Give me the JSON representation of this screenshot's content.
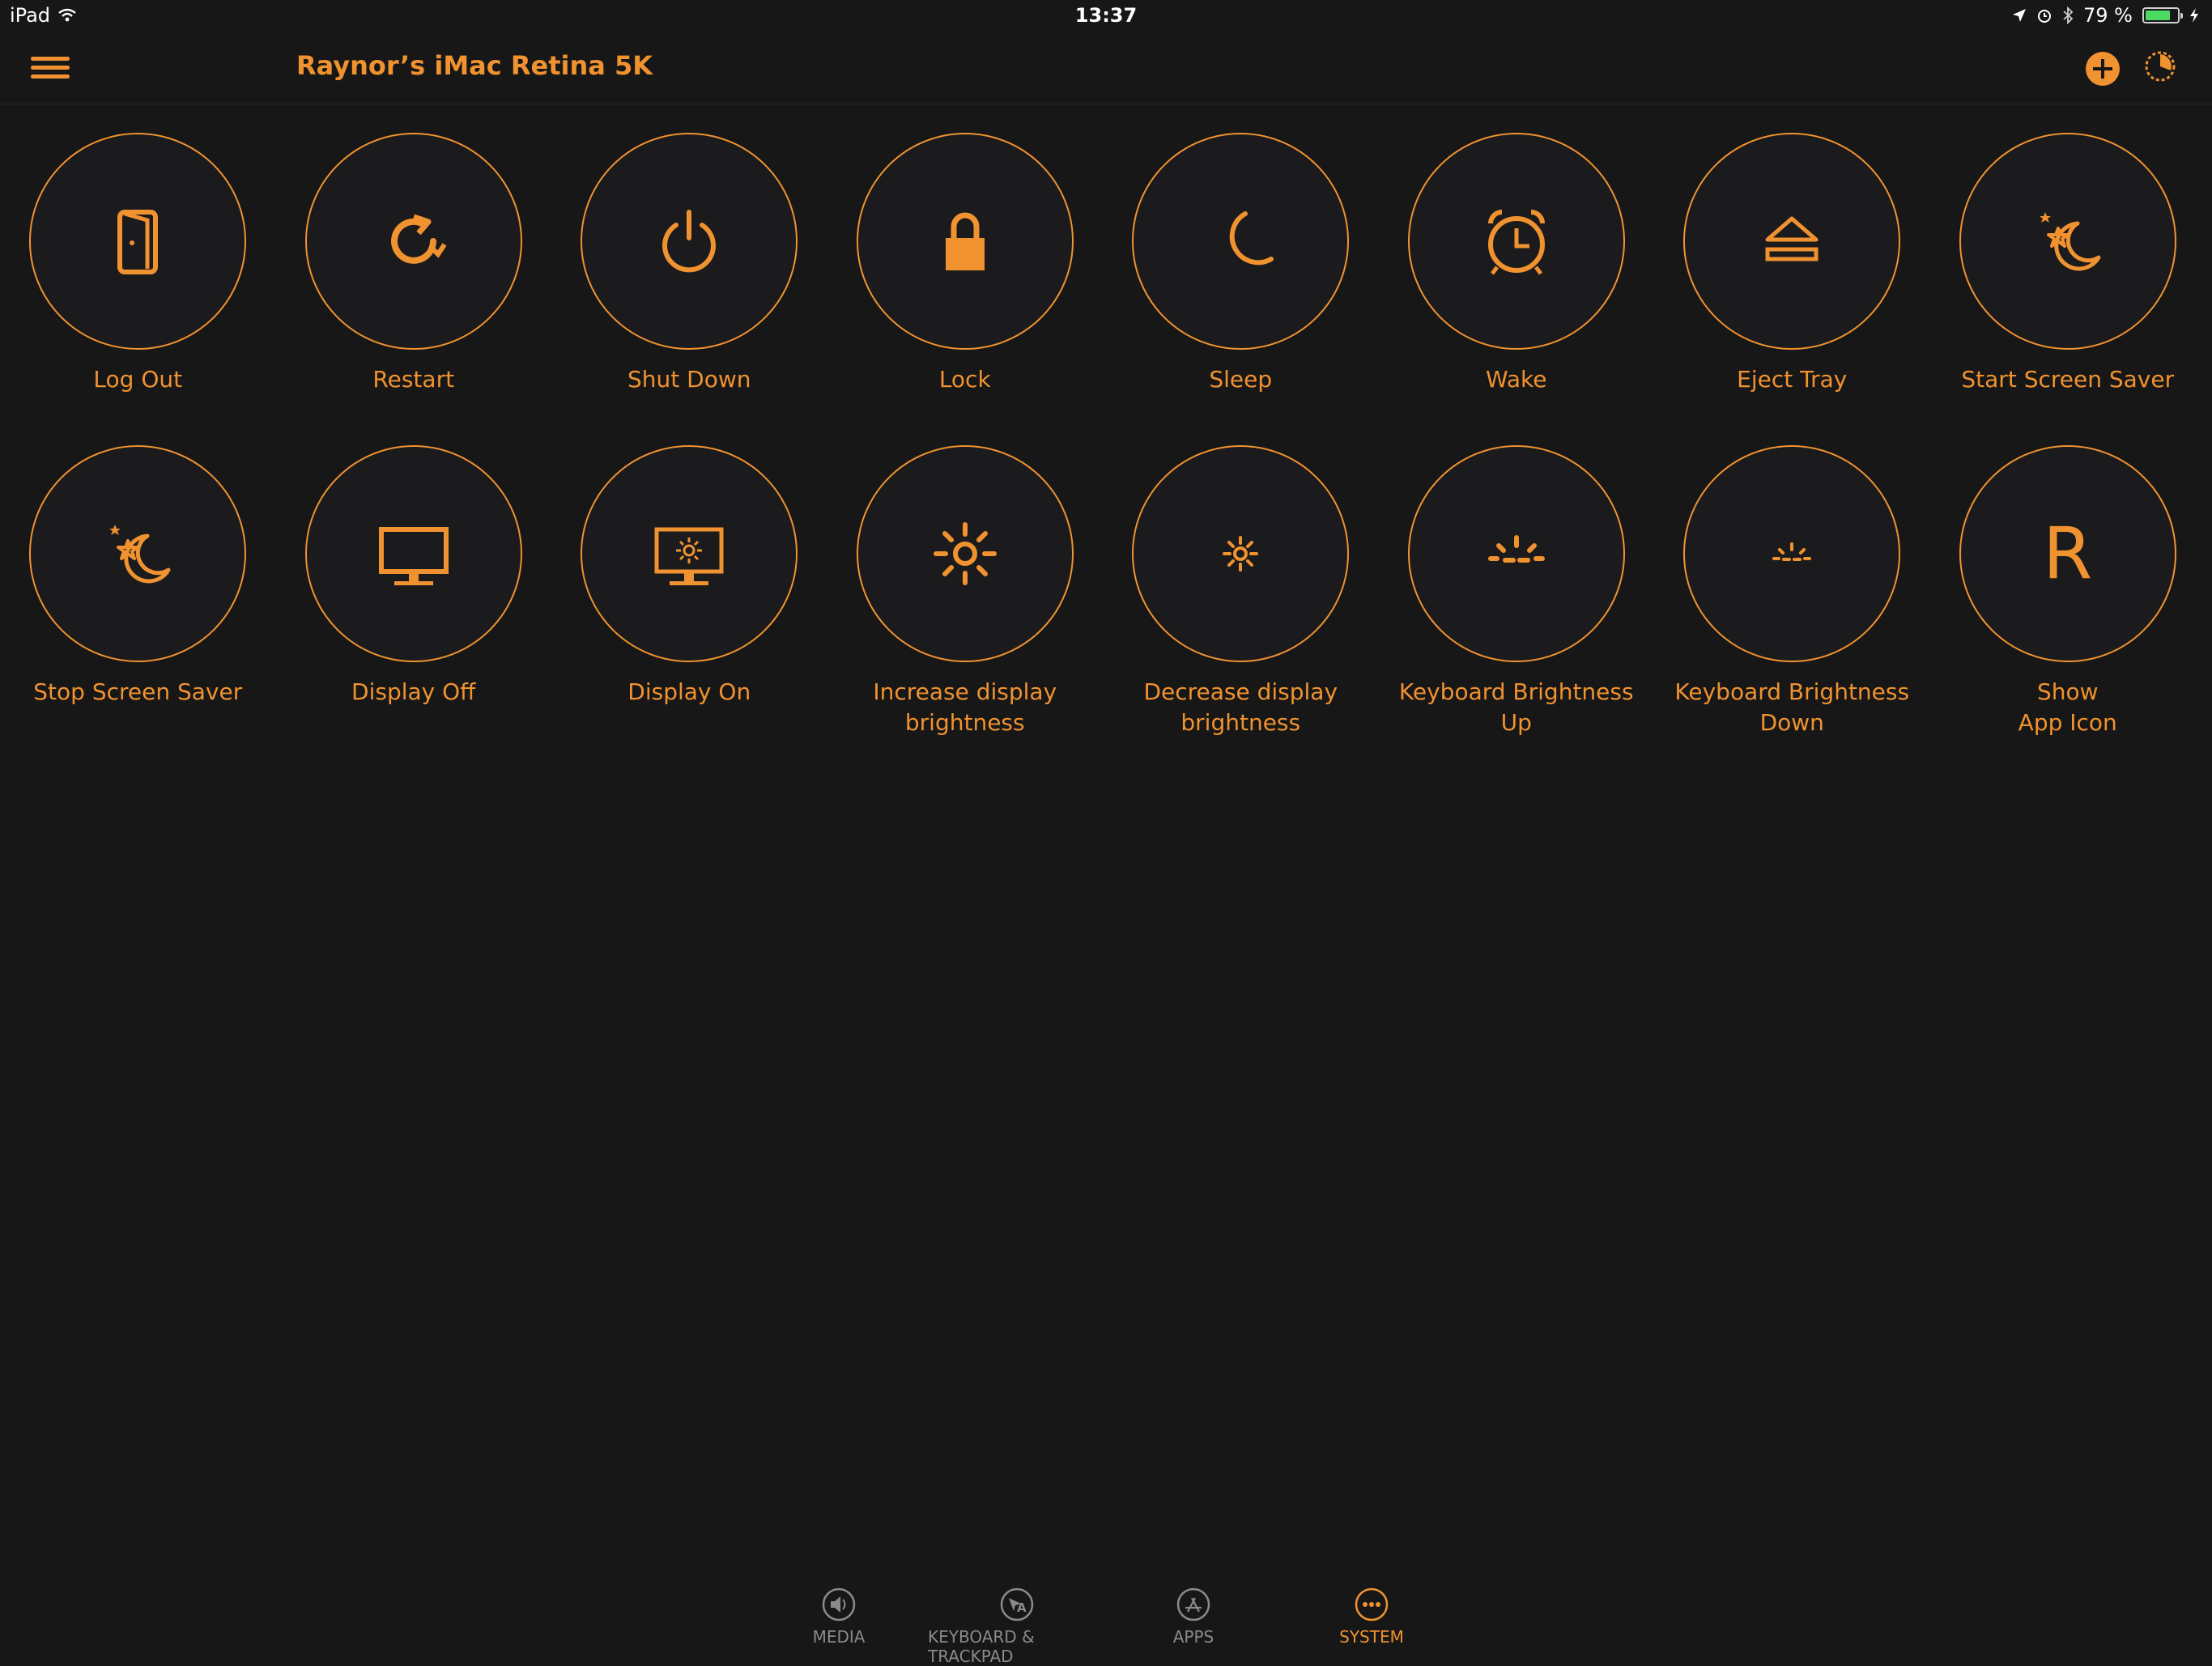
{
  "status_bar": {
    "device": "iPad",
    "time": "13:37",
    "battery_percent": "79 %",
    "battery_level": 0.79
  },
  "navbar": {
    "title": "Raynor’s iMac Retina 5K"
  },
  "actions": [
    {
      "label": "Log Out",
      "icon": "door-icon"
    },
    {
      "label": "Restart",
      "icon": "restart-icon"
    },
    {
      "label": "Shut Down",
      "icon": "power-icon"
    },
    {
      "label": "Lock",
      "icon": "lock-icon"
    },
    {
      "label": "Sleep",
      "icon": "moon-icon"
    },
    {
      "label": "Wake",
      "icon": "alarm-clock-icon"
    },
    {
      "label": "Eject Tray",
      "icon": "eject-icon"
    },
    {
      "label": "Start Screen Saver",
      "icon": "moon-stars-icon"
    },
    {
      "label": "Stop Screen Saver",
      "icon": "moon-stars-icon"
    },
    {
      "label": "Display Off",
      "icon": "monitor-icon"
    },
    {
      "label": "Display On",
      "icon": "monitor-sun-icon"
    },
    {
      "label": "Increase display\nbrightness",
      "icon": "sun-large-icon"
    },
    {
      "label": "Decrease display\nbrightness",
      "icon": "sun-small-icon"
    },
    {
      "label": "Keyboard Brightness\nUp",
      "icon": "keyboard-brightness-up-icon"
    },
    {
      "label": "Keyboard Brightness\nDown",
      "icon": "keyboard-brightness-down-icon"
    },
    {
      "label": "Show\nApp Icon",
      "icon": "letter-r-icon",
      "glyph": "R"
    }
  ],
  "tabs": [
    {
      "label": "MEDIA",
      "icon": "speaker-icon",
      "active": false
    },
    {
      "label": "KEYBOARD & TRACKPAD",
      "icon": "keyboard-icon",
      "active": false
    },
    {
      "label": "APPS",
      "icon": "app-store-icon",
      "active": false
    },
    {
      "label": "SYSTEM",
      "icon": "more-icon",
      "active": true
    }
  ],
  "colors": {
    "accent": "#f0922f",
    "background": "#171717",
    "inactive_tab": "#8a8a8a",
    "battery": "#4cd964"
  }
}
